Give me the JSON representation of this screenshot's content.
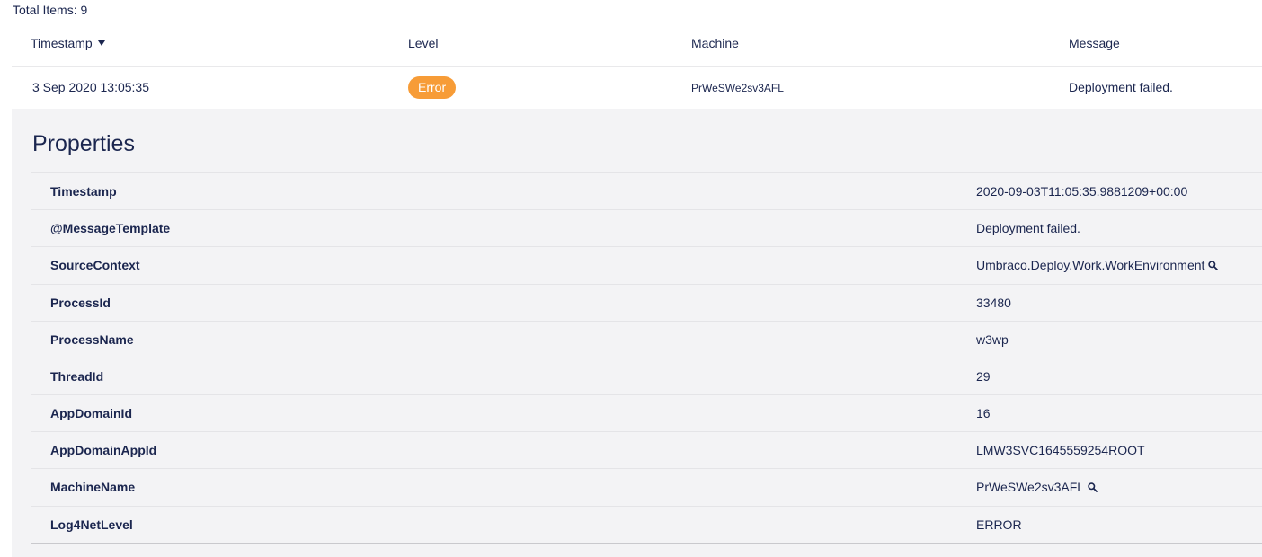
{
  "total_items_label": "Total Items: 9",
  "columns": {
    "timestamp": "Timestamp",
    "level": "Level",
    "machine": "Machine",
    "message": "Message"
  },
  "entry": {
    "timestamp": "3 Sep 2020 13:05:35",
    "level": "Error",
    "level_color": "#f79c37",
    "machine": "PrWeSWe2sv3AFL",
    "message": "Deployment failed."
  },
  "properties": {
    "title": "Properties",
    "rows": [
      {
        "key": "Timestamp",
        "value": "2020-09-03T11:05:35.9881209+00:00"
      },
      {
        "key": "@MessageTemplate",
        "value": "Deployment failed."
      },
      {
        "key": "SourceContext",
        "value": "Umbraco.Deploy.Work.WorkEnvironment",
        "icon": "search-icon"
      },
      {
        "key": "ProcessId",
        "value": "33480"
      },
      {
        "key": "ProcessName",
        "value": "w3wp"
      },
      {
        "key": "ThreadId",
        "value": "29"
      },
      {
        "key": "AppDomainId",
        "value": "16"
      },
      {
        "key": "AppDomainAppId",
        "value": "LMW3SVC1645559254ROOT"
      },
      {
        "key": "MachineName",
        "value": "PrWeSWe2sv3AFL",
        "icon": "search-icon"
      },
      {
        "key": "Log4NetLevel",
        "value": "ERROR"
      }
    ]
  }
}
